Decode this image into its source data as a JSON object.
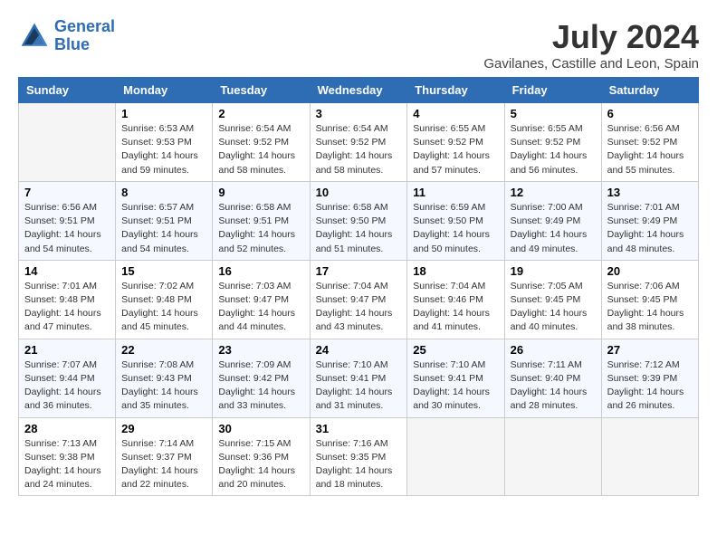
{
  "header": {
    "logo_line1": "General",
    "logo_line2": "Blue",
    "month": "July 2024",
    "location": "Gavilanes, Castille and Leon, Spain"
  },
  "weekdays": [
    "Sunday",
    "Monday",
    "Tuesday",
    "Wednesday",
    "Thursday",
    "Friday",
    "Saturday"
  ],
  "weeks": [
    [
      {
        "day": "",
        "sunrise": "",
        "sunset": "",
        "daylight": ""
      },
      {
        "day": "1",
        "sunrise": "Sunrise: 6:53 AM",
        "sunset": "Sunset: 9:53 PM",
        "daylight": "Daylight: 14 hours and 59 minutes."
      },
      {
        "day": "2",
        "sunrise": "Sunrise: 6:54 AM",
        "sunset": "Sunset: 9:52 PM",
        "daylight": "Daylight: 14 hours and 58 minutes."
      },
      {
        "day": "3",
        "sunrise": "Sunrise: 6:54 AM",
        "sunset": "Sunset: 9:52 PM",
        "daylight": "Daylight: 14 hours and 58 minutes."
      },
      {
        "day": "4",
        "sunrise": "Sunrise: 6:55 AM",
        "sunset": "Sunset: 9:52 PM",
        "daylight": "Daylight: 14 hours and 57 minutes."
      },
      {
        "day": "5",
        "sunrise": "Sunrise: 6:55 AM",
        "sunset": "Sunset: 9:52 PM",
        "daylight": "Daylight: 14 hours and 56 minutes."
      },
      {
        "day": "6",
        "sunrise": "Sunrise: 6:56 AM",
        "sunset": "Sunset: 9:52 PM",
        "daylight": "Daylight: 14 hours and 55 minutes."
      }
    ],
    [
      {
        "day": "7",
        "sunrise": "Sunrise: 6:56 AM",
        "sunset": "Sunset: 9:51 PM",
        "daylight": "Daylight: 14 hours and 54 minutes."
      },
      {
        "day": "8",
        "sunrise": "Sunrise: 6:57 AM",
        "sunset": "Sunset: 9:51 PM",
        "daylight": "Daylight: 14 hours and 54 minutes."
      },
      {
        "day": "9",
        "sunrise": "Sunrise: 6:58 AM",
        "sunset": "Sunset: 9:51 PM",
        "daylight": "Daylight: 14 hours and 52 minutes."
      },
      {
        "day": "10",
        "sunrise": "Sunrise: 6:58 AM",
        "sunset": "Sunset: 9:50 PM",
        "daylight": "Daylight: 14 hours and 51 minutes."
      },
      {
        "day": "11",
        "sunrise": "Sunrise: 6:59 AM",
        "sunset": "Sunset: 9:50 PM",
        "daylight": "Daylight: 14 hours and 50 minutes."
      },
      {
        "day": "12",
        "sunrise": "Sunrise: 7:00 AM",
        "sunset": "Sunset: 9:49 PM",
        "daylight": "Daylight: 14 hours and 49 minutes."
      },
      {
        "day": "13",
        "sunrise": "Sunrise: 7:01 AM",
        "sunset": "Sunset: 9:49 PM",
        "daylight": "Daylight: 14 hours and 48 minutes."
      }
    ],
    [
      {
        "day": "14",
        "sunrise": "Sunrise: 7:01 AM",
        "sunset": "Sunset: 9:48 PM",
        "daylight": "Daylight: 14 hours and 47 minutes."
      },
      {
        "day": "15",
        "sunrise": "Sunrise: 7:02 AM",
        "sunset": "Sunset: 9:48 PM",
        "daylight": "Daylight: 14 hours and 45 minutes."
      },
      {
        "day": "16",
        "sunrise": "Sunrise: 7:03 AM",
        "sunset": "Sunset: 9:47 PM",
        "daylight": "Daylight: 14 hours and 44 minutes."
      },
      {
        "day": "17",
        "sunrise": "Sunrise: 7:04 AM",
        "sunset": "Sunset: 9:47 PM",
        "daylight": "Daylight: 14 hours and 43 minutes."
      },
      {
        "day": "18",
        "sunrise": "Sunrise: 7:04 AM",
        "sunset": "Sunset: 9:46 PM",
        "daylight": "Daylight: 14 hours and 41 minutes."
      },
      {
        "day": "19",
        "sunrise": "Sunrise: 7:05 AM",
        "sunset": "Sunset: 9:45 PM",
        "daylight": "Daylight: 14 hours and 40 minutes."
      },
      {
        "day": "20",
        "sunrise": "Sunrise: 7:06 AM",
        "sunset": "Sunset: 9:45 PM",
        "daylight": "Daylight: 14 hours and 38 minutes."
      }
    ],
    [
      {
        "day": "21",
        "sunrise": "Sunrise: 7:07 AM",
        "sunset": "Sunset: 9:44 PM",
        "daylight": "Daylight: 14 hours and 36 minutes."
      },
      {
        "day": "22",
        "sunrise": "Sunrise: 7:08 AM",
        "sunset": "Sunset: 9:43 PM",
        "daylight": "Daylight: 14 hours and 35 minutes."
      },
      {
        "day": "23",
        "sunrise": "Sunrise: 7:09 AM",
        "sunset": "Sunset: 9:42 PM",
        "daylight": "Daylight: 14 hours and 33 minutes."
      },
      {
        "day": "24",
        "sunrise": "Sunrise: 7:10 AM",
        "sunset": "Sunset: 9:41 PM",
        "daylight": "Daylight: 14 hours and 31 minutes."
      },
      {
        "day": "25",
        "sunrise": "Sunrise: 7:10 AM",
        "sunset": "Sunset: 9:41 PM",
        "daylight": "Daylight: 14 hours and 30 minutes."
      },
      {
        "day": "26",
        "sunrise": "Sunrise: 7:11 AM",
        "sunset": "Sunset: 9:40 PM",
        "daylight": "Daylight: 14 hours and 28 minutes."
      },
      {
        "day": "27",
        "sunrise": "Sunrise: 7:12 AM",
        "sunset": "Sunset: 9:39 PM",
        "daylight": "Daylight: 14 hours and 26 minutes."
      }
    ],
    [
      {
        "day": "28",
        "sunrise": "Sunrise: 7:13 AM",
        "sunset": "Sunset: 9:38 PM",
        "daylight": "Daylight: 14 hours and 24 minutes."
      },
      {
        "day": "29",
        "sunrise": "Sunrise: 7:14 AM",
        "sunset": "Sunset: 9:37 PM",
        "daylight": "Daylight: 14 hours and 22 minutes."
      },
      {
        "day": "30",
        "sunrise": "Sunrise: 7:15 AM",
        "sunset": "Sunset: 9:36 PM",
        "daylight": "Daylight: 14 hours and 20 minutes."
      },
      {
        "day": "31",
        "sunrise": "Sunrise: 7:16 AM",
        "sunset": "Sunset: 9:35 PM",
        "daylight": "Daylight: 14 hours and 18 minutes."
      },
      {
        "day": "",
        "sunrise": "",
        "sunset": "",
        "daylight": ""
      },
      {
        "day": "",
        "sunrise": "",
        "sunset": "",
        "daylight": ""
      },
      {
        "day": "",
        "sunrise": "",
        "sunset": "",
        "daylight": ""
      }
    ]
  ]
}
